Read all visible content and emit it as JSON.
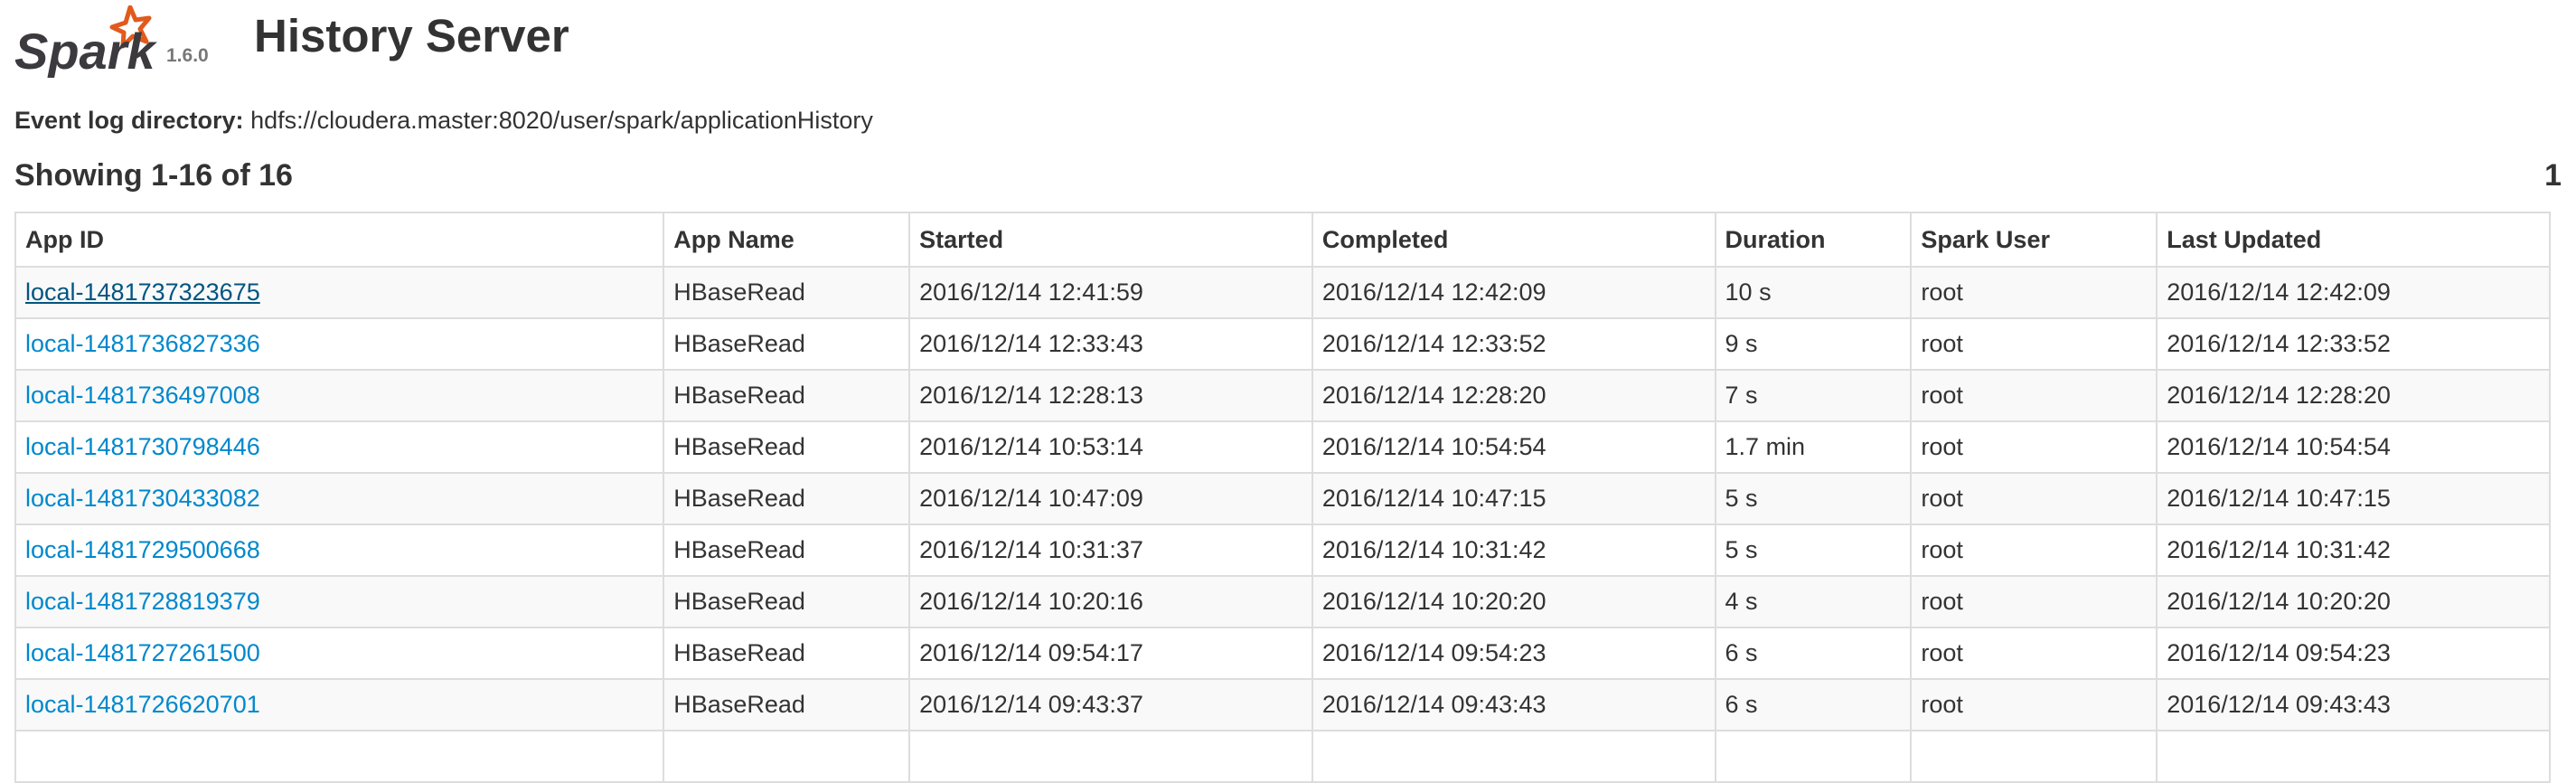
{
  "header": {
    "logo_text": "Spark",
    "version": "1.6.0",
    "title": "History Server"
  },
  "event_log": {
    "label": "Event log directory:",
    "path": "hdfs://cloudera.master:8020/user/spark/applicationHistory"
  },
  "pagination": {
    "showing": "Showing 1-16 of 16",
    "current_page": "1"
  },
  "table": {
    "columns": [
      "App ID",
      "App Name",
      "Started",
      "Completed",
      "Duration",
      "Spark User",
      "Last Updated"
    ],
    "rows": [
      {
        "app_id": "local-1481737323675",
        "app_name": "HBaseRead",
        "started": "2016/12/14 12:41:59",
        "completed": "2016/12/14 12:42:09",
        "duration": "10 s",
        "user": "root",
        "last_updated": "2016/12/14 12:42:09"
      },
      {
        "app_id": "local-1481736827336",
        "app_name": "HBaseRead",
        "started": "2016/12/14 12:33:43",
        "completed": "2016/12/14 12:33:52",
        "duration": "9 s",
        "user": "root",
        "last_updated": "2016/12/14 12:33:52"
      },
      {
        "app_id": "local-1481736497008",
        "app_name": "HBaseRead",
        "started": "2016/12/14 12:28:13",
        "completed": "2016/12/14 12:28:20",
        "duration": "7 s",
        "user": "root",
        "last_updated": "2016/12/14 12:28:20"
      },
      {
        "app_id": "local-1481730798446",
        "app_name": "HBaseRead",
        "started": "2016/12/14 10:53:14",
        "completed": "2016/12/14 10:54:54",
        "duration": "1.7 min",
        "user": "root",
        "last_updated": "2016/12/14 10:54:54"
      },
      {
        "app_id": "local-1481730433082",
        "app_name": "HBaseRead",
        "started": "2016/12/14 10:47:09",
        "completed": "2016/12/14 10:47:15",
        "duration": "5 s",
        "user": "root",
        "last_updated": "2016/12/14 10:47:15"
      },
      {
        "app_id": "local-1481729500668",
        "app_name": "HBaseRead",
        "started": "2016/12/14 10:31:37",
        "completed": "2016/12/14 10:31:42",
        "duration": "5 s",
        "user": "root",
        "last_updated": "2016/12/14 10:31:42"
      },
      {
        "app_id": "local-1481728819379",
        "app_name": "HBaseRead",
        "started": "2016/12/14 10:20:16",
        "completed": "2016/12/14 10:20:20",
        "duration": "4 s",
        "user": "root",
        "last_updated": "2016/12/14 10:20:20"
      },
      {
        "app_id": "local-1481727261500",
        "app_name": "HBaseRead",
        "started": "2016/12/14 09:54:17",
        "completed": "2016/12/14 09:54:23",
        "duration": "6 s",
        "user": "root",
        "last_updated": "2016/12/14 09:54:23"
      },
      {
        "app_id": "local-1481726620701",
        "app_name": "HBaseRead",
        "started": "2016/12/14 09:43:37",
        "completed": "2016/12/14 09:43:43",
        "duration": "6 s",
        "user": "root",
        "last_updated": "2016/12/14 09:43:43"
      },
      {
        "app_id": "",
        "app_name": "",
        "started": "",
        "completed": "",
        "duration": "",
        "user": "",
        "last_updated": ""
      }
    ]
  },
  "colors": {
    "link": "#0088cc",
    "link_focused": "#005580",
    "logo_star": "#e25a1c",
    "logo_text": "#3c3a3e",
    "border": "#dddddd",
    "stripe": "#f9f9f9"
  }
}
